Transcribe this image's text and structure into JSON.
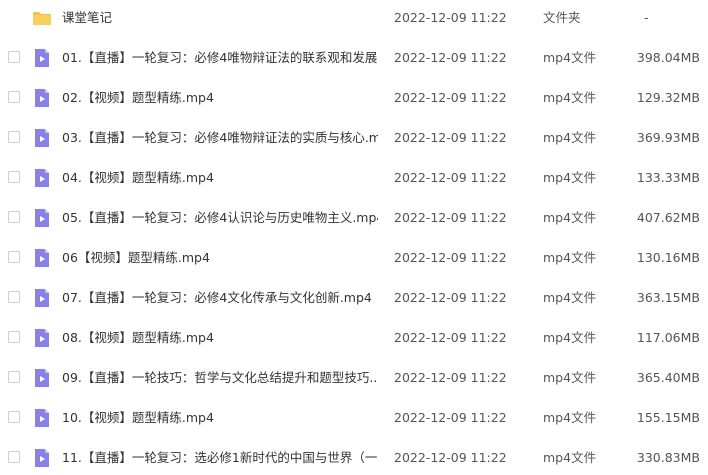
{
  "files": [
    {
      "name": "课堂笔记",
      "date": "2022-12-09 11:22",
      "type": "文件夹",
      "size": "-",
      "icon": "folder-icon"
    },
    {
      "name": "01.【直播】一轮复习：必修4唯物辩证法的联系观和发展...",
      "date": "2022-12-09 11:22",
      "type": "mp4文件",
      "size": "398.04MB",
      "icon": "video-file-icon"
    },
    {
      "name": "02.【视频】题型精练.mp4",
      "date": "2022-12-09 11:22",
      "type": "mp4文件",
      "size": "129.32MB",
      "icon": "video-file-icon"
    },
    {
      "name": "03.【直播】一轮复习：必修4唯物辩证法的实质与核心.m...",
      "date": "2022-12-09 11:22",
      "type": "mp4文件",
      "size": "369.93MB",
      "icon": "video-file-icon"
    },
    {
      "name": "04.【视频】题型精练.mp4",
      "date": "2022-12-09 11:22",
      "type": "mp4文件",
      "size": "133.33MB",
      "icon": "video-file-icon"
    },
    {
      "name": "05.【直播】一轮复习：必修4认识论与历史唯物主义.mp4",
      "date": "2022-12-09 11:22",
      "type": "mp4文件",
      "size": "407.62MB",
      "icon": "video-file-icon"
    },
    {
      "name": "06【视频】题型精练.mp4",
      "date": "2022-12-09 11:22",
      "type": "mp4文件",
      "size": "130.16MB",
      "icon": "video-file-icon"
    },
    {
      "name": "07.【直播】一轮复习：必修4文化传承与文化创新.mp4",
      "date": "2022-12-09 11:22",
      "type": "mp4文件",
      "size": "363.15MB",
      "icon": "video-file-icon"
    },
    {
      "name": "08.【视频】题型精练.mp4",
      "date": "2022-12-09 11:22",
      "type": "mp4文件",
      "size": "117.06MB",
      "icon": "video-file-icon"
    },
    {
      "name": "09.【直播】一轮技巧：哲学与文化总结提升和题型技巧....",
      "date": "2022-12-09 11:22",
      "type": "mp4文件",
      "size": "365.40MB",
      "icon": "video-file-icon"
    },
    {
      "name": "10.【视频】题型精练.mp4",
      "date": "2022-12-09 11:22",
      "type": "mp4文件",
      "size": "155.15MB",
      "icon": "video-file-icon"
    },
    {
      "name": "11.【直播】一轮复习：选必修1新时代的中国与世界（一...",
      "date": "2022-12-09 11:22",
      "type": "mp4文件",
      "size": "330.83MB",
      "icon": "video-file-icon"
    }
  ],
  "colors": {
    "folder": "#f5c342",
    "video_icon": "#8b7fe8",
    "video_icon_fold": "#c7c0f7"
  }
}
